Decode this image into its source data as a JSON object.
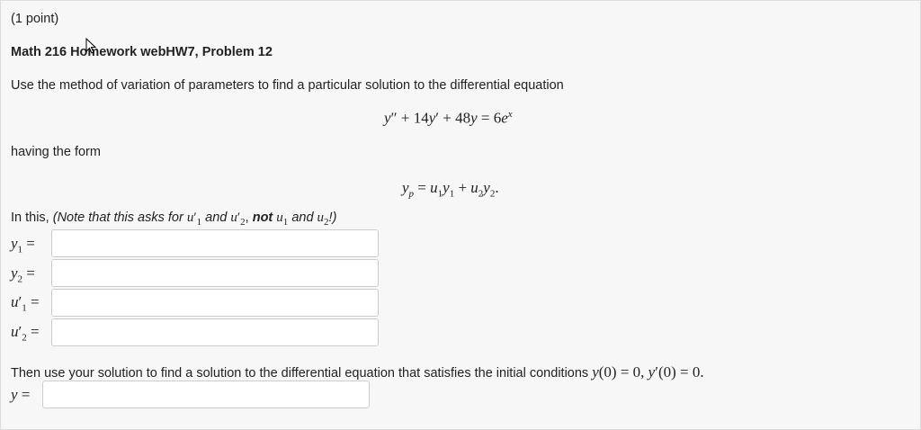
{
  "problem": {
    "points": "(1 point)",
    "title": "Math 216 Homework webHW7, Problem 12",
    "instruction": "Use the method of variation of parameters to find a particular solution to the differential equation",
    "having_form": "having the form",
    "note_intro": "In this, ",
    "note_part1": "(Note that this asks for ",
    "note_and1": " and ",
    "note_not": " not ",
    "note_and2": " and ",
    "note_end": "!)",
    "followup": "Then use your solution to find a solution to the differential equation that satisfies the initial conditions "
  },
  "equations": {
    "ode": "y″ + 14y′ + 48y = 6eˣ",
    "form": "yₚ = u₁y₁ + u₂y₂."
  },
  "answers": {
    "y1": "",
    "y2": "",
    "u1p": "",
    "u2p": "",
    "y": ""
  }
}
